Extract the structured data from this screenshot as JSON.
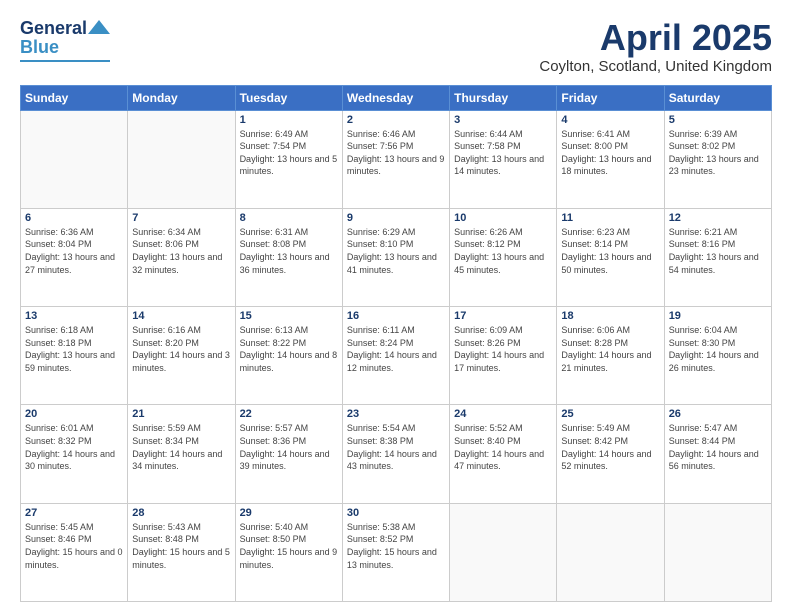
{
  "header": {
    "logo_general": "General",
    "logo_blue": "Blue",
    "title": "April 2025",
    "subtitle": "Coylton, Scotland, United Kingdom"
  },
  "weekdays": [
    "Sunday",
    "Monday",
    "Tuesday",
    "Wednesday",
    "Thursday",
    "Friday",
    "Saturday"
  ],
  "weeks": [
    [
      {
        "day": "",
        "info": ""
      },
      {
        "day": "",
        "info": ""
      },
      {
        "day": "1",
        "info": "Sunrise: 6:49 AM\nSunset: 7:54 PM\nDaylight: 13 hours and 5 minutes."
      },
      {
        "day": "2",
        "info": "Sunrise: 6:46 AM\nSunset: 7:56 PM\nDaylight: 13 hours and 9 minutes."
      },
      {
        "day": "3",
        "info": "Sunrise: 6:44 AM\nSunset: 7:58 PM\nDaylight: 13 hours and 14 minutes."
      },
      {
        "day": "4",
        "info": "Sunrise: 6:41 AM\nSunset: 8:00 PM\nDaylight: 13 hours and 18 minutes."
      },
      {
        "day": "5",
        "info": "Sunrise: 6:39 AM\nSunset: 8:02 PM\nDaylight: 13 hours and 23 minutes."
      }
    ],
    [
      {
        "day": "6",
        "info": "Sunrise: 6:36 AM\nSunset: 8:04 PM\nDaylight: 13 hours and 27 minutes."
      },
      {
        "day": "7",
        "info": "Sunrise: 6:34 AM\nSunset: 8:06 PM\nDaylight: 13 hours and 32 minutes."
      },
      {
        "day": "8",
        "info": "Sunrise: 6:31 AM\nSunset: 8:08 PM\nDaylight: 13 hours and 36 minutes."
      },
      {
        "day": "9",
        "info": "Sunrise: 6:29 AM\nSunset: 8:10 PM\nDaylight: 13 hours and 41 minutes."
      },
      {
        "day": "10",
        "info": "Sunrise: 6:26 AM\nSunset: 8:12 PM\nDaylight: 13 hours and 45 minutes."
      },
      {
        "day": "11",
        "info": "Sunrise: 6:23 AM\nSunset: 8:14 PM\nDaylight: 13 hours and 50 minutes."
      },
      {
        "day": "12",
        "info": "Sunrise: 6:21 AM\nSunset: 8:16 PM\nDaylight: 13 hours and 54 minutes."
      }
    ],
    [
      {
        "day": "13",
        "info": "Sunrise: 6:18 AM\nSunset: 8:18 PM\nDaylight: 13 hours and 59 minutes."
      },
      {
        "day": "14",
        "info": "Sunrise: 6:16 AM\nSunset: 8:20 PM\nDaylight: 14 hours and 3 minutes."
      },
      {
        "day": "15",
        "info": "Sunrise: 6:13 AM\nSunset: 8:22 PM\nDaylight: 14 hours and 8 minutes."
      },
      {
        "day": "16",
        "info": "Sunrise: 6:11 AM\nSunset: 8:24 PM\nDaylight: 14 hours and 12 minutes."
      },
      {
        "day": "17",
        "info": "Sunrise: 6:09 AM\nSunset: 8:26 PM\nDaylight: 14 hours and 17 minutes."
      },
      {
        "day": "18",
        "info": "Sunrise: 6:06 AM\nSunset: 8:28 PM\nDaylight: 14 hours and 21 minutes."
      },
      {
        "day": "19",
        "info": "Sunrise: 6:04 AM\nSunset: 8:30 PM\nDaylight: 14 hours and 26 minutes."
      }
    ],
    [
      {
        "day": "20",
        "info": "Sunrise: 6:01 AM\nSunset: 8:32 PM\nDaylight: 14 hours and 30 minutes."
      },
      {
        "day": "21",
        "info": "Sunrise: 5:59 AM\nSunset: 8:34 PM\nDaylight: 14 hours and 34 minutes."
      },
      {
        "day": "22",
        "info": "Sunrise: 5:57 AM\nSunset: 8:36 PM\nDaylight: 14 hours and 39 minutes."
      },
      {
        "day": "23",
        "info": "Sunrise: 5:54 AM\nSunset: 8:38 PM\nDaylight: 14 hours and 43 minutes."
      },
      {
        "day": "24",
        "info": "Sunrise: 5:52 AM\nSunset: 8:40 PM\nDaylight: 14 hours and 47 minutes."
      },
      {
        "day": "25",
        "info": "Sunrise: 5:49 AM\nSunset: 8:42 PM\nDaylight: 14 hours and 52 minutes."
      },
      {
        "day": "26",
        "info": "Sunrise: 5:47 AM\nSunset: 8:44 PM\nDaylight: 14 hours and 56 minutes."
      }
    ],
    [
      {
        "day": "27",
        "info": "Sunrise: 5:45 AM\nSunset: 8:46 PM\nDaylight: 15 hours and 0 minutes."
      },
      {
        "day": "28",
        "info": "Sunrise: 5:43 AM\nSunset: 8:48 PM\nDaylight: 15 hours and 5 minutes."
      },
      {
        "day": "29",
        "info": "Sunrise: 5:40 AM\nSunset: 8:50 PM\nDaylight: 15 hours and 9 minutes."
      },
      {
        "day": "30",
        "info": "Sunrise: 5:38 AM\nSunset: 8:52 PM\nDaylight: 15 hours and 13 minutes."
      },
      {
        "day": "",
        "info": ""
      },
      {
        "day": "",
        "info": ""
      },
      {
        "day": "",
        "info": ""
      }
    ]
  ]
}
